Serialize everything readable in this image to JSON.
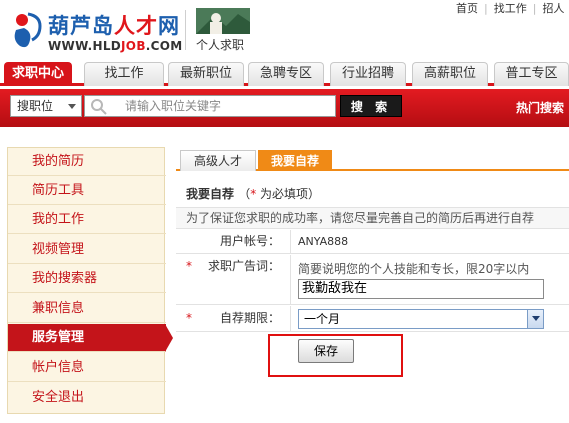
{
  "header": {
    "logo_cn_part1": "葫芦岛",
    "logo_cn_part2": "人才",
    "logo_cn_part3": "网",
    "logo_en_part1": "WWW.HLD",
    "logo_en_part2": "JOB",
    "logo_en_part3": ".COM",
    "sub_logo_label": "个人求职",
    "top_links": [
      "首页",
      "找工作",
      "招人"
    ]
  },
  "nav": {
    "tabs": [
      {
        "label": "求职中心",
        "active": true
      },
      {
        "label": "找工作",
        "active": false
      },
      {
        "label": "最新职位",
        "active": false
      },
      {
        "label": "急聘专区",
        "active": false
      },
      {
        "label": "行业招聘",
        "active": false
      },
      {
        "label": "高薪职位",
        "active": false
      },
      {
        "label": "普工专区",
        "active": false
      }
    ]
  },
  "search": {
    "type_selected": "搜职位",
    "placeholder": "请输入职位关键字",
    "button_label": "搜 索",
    "hot_label": "热门搜索"
  },
  "sidebar": {
    "items": [
      {
        "label": "我的简历",
        "active": false
      },
      {
        "label": "简历工具",
        "active": false
      },
      {
        "label": "我的工作",
        "active": false
      },
      {
        "label": "视频管理",
        "active": false
      },
      {
        "label": "我的搜索器",
        "active": false
      },
      {
        "label": "兼职信息",
        "active": false
      },
      {
        "label": "服务管理",
        "active": true
      },
      {
        "label": "帐户信息",
        "active": false
      },
      {
        "label": "安全退出",
        "active": false
      }
    ]
  },
  "content": {
    "tabs": [
      {
        "label": "高级人才",
        "active": false
      },
      {
        "label": "我要自荐",
        "active": true
      }
    ],
    "section_title": "我要自荐",
    "required_note_prefix": "（",
    "required_star": "*",
    "required_note": " 为必填项）",
    "hint": "为了保证您求职的成功率，请您尽量完善自己的简历后再进行自荐",
    "form": {
      "account_label": "用户帐号：",
      "account_value": "ANYA888",
      "ad_label": "求职广告词：",
      "ad_hint": "简要说明您的个人技能和专长，限20字以内",
      "ad_value": "我勤敌我在",
      "period_label": "自荐期限：",
      "period_value": "一个月",
      "star": "*"
    },
    "save_label": "保存"
  },
  "colors": {
    "brand_red": "#d7141a",
    "tab_orange": "#f08a16",
    "sidebar_bg": "#fcf5e3",
    "highlight_frame": "#e01010"
  }
}
